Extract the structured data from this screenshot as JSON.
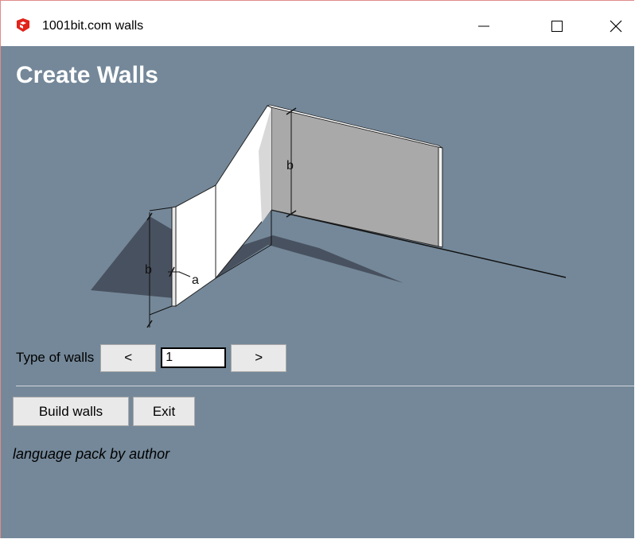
{
  "window": {
    "title": "1001bit.com walls",
    "app_icon": "sketchup-icon",
    "controls": [
      "minimize-icon",
      "maximize-icon",
      "close-icon"
    ]
  },
  "main": {
    "heading": "Create Walls",
    "illustration": {
      "description_icon": "walls-diagram",
      "labels": {
        "height_label": "b",
        "thickness_label": "a"
      }
    },
    "type_selector": {
      "label": "Type of walls",
      "prev_label": "<",
      "next_label": ">",
      "value": "1"
    },
    "actions": {
      "build_label": "Build walls",
      "exit_label": "Exit"
    },
    "credit": "language pack by author"
  },
  "colors": {
    "background": "#748899",
    "heading": "#ffffff",
    "button_face": "#e9e9e9",
    "wall_light": "#ffffff",
    "wall_grey": "#a8a8a8",
    "shadow": "#3a4048"
  }
}
